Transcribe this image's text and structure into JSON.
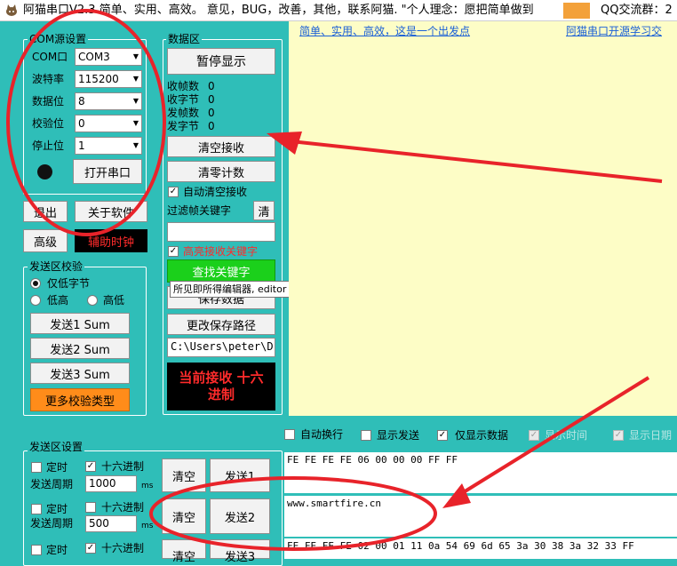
{
  "titlebar": {
    "title": "阿猫串口V2.3  简单、实用、高效。 意见，BUG，改善，其他，联系阿猫. \"个人理念：愿把简单做到",
    "qq": "QQ交流群：2"
  },
  "com": {
    "group_label": "COM源设置",
    "port_label": "COM口",
    "port_value": "COM3",
    "baud_label": "波特率",
    "baud_value": "115200",
    "databits_label": "数据位",
    "databits_value": "8",
    "parity_label": "校验位",
    "parity_value": "0",
    "stopbits_label": "停止位",
    "stopbits_value": "1",
    "open_button": "打开串口"
  },
  "left_buttons": {
    "exit": "退出",
    "about": "关于软件",
    "advanced": "高级",
    "clock": "辅助时钟"
  },
  "send_check": {
    "group_label": "发送区校验",
    "option_low": "仅低字节",
    "option_lowhigh": "低高",
    "option_highlow": "高低",
    "send1": "发送1 Sum",
    "send2": "发送2 Sum",
    "send3": "发送3 Sum",
    "more": "更多校验类型"
  },
  "data_area": {
    "group_label": "数据区",
    "pause": "暂停显示",
    "rx_frames": "收帧数",
    "rx_frames_value": "0",
    "rx_bytes": "收字节",
    "rx_bytes_value": "0",
    "tx_frames": "发帧数",
    "tx_frames_value": "0",
    "tx_bytes": "发字节",
    "tx_bytes_value": "0",
    "clear_rx": "清空接收",
    "clear_count": "清零计数",
    "auto_clear": "自动清空接收",
    "filter_label": "过滤帧关键字",
    "filter_clear": "清",
    "highlight": "高亮接收关键字",
    "find": "查找关键字",
    "save": "保存数据",
    "change_path": "更改保存路径",
    "path": "C:\\Users\\peter\\D",
    "hex_status": "当前接收  十六进制"
  },
  "tooltip": "所见即所得编辑器, editor",
  "receive": {
    "link_left": "简单、实用、高效，这是一个出发点",
    "link_right": "阿猫串口开源学习交"
  },
  "options": {
    "auto_wrap": "自动换行",
    "show_send": "显示发送",
    "show_data_only": "仅显示数据",
    "show_time": "显示时间",
    "show_date": "显示日期"
  },
  "send_area": {
    "group_label": "发送区设置",
    "timer": "定时",
    "hex": "十六进制",
    "period": "发送周期",
    "period1": "1000",
    "period2": "500",
    "unit": "ms",
    "clear": "清空",
    "send1": "发送1",
    "send2": "发送2",
    "send3": "发送3",
    "text1": "FE FE FE FE 06 00 00 00 FF FF",
    "text2": "www.smartfire.cn",
    "text3": "FE FE FE FE 02 00 01 11 0a 54 69 6d 65 3a 30 38 3a 32 33 FF"
  },
  "colors": {
    "background": "#2fbeb8",
    "receive_bg": "#fdfdc6",
    "annotation": "#e8232a",
    "find_button": "#1bd01b",
    "more_button": "#ff8c1a"
  }
}
